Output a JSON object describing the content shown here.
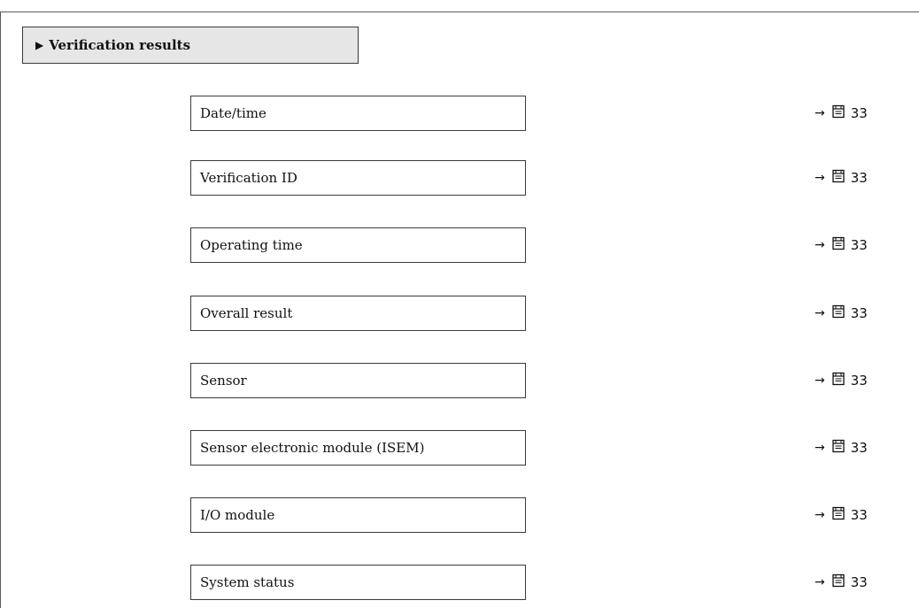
{
  "section": {
    "title": "Verification results",
    "expand_icon": "triangle-right-icon"
  },
  "parameters": [
    {
      "label": "Date/time",
      "ref_arrow": "→",
      "ref_page": "33"
    },
    {
      "label": "Verification ID",
      "ref_arrow": "→",
      "ref_page": "33"
    },
    {
      "label": "Operating time",
      "ref_arrow": "→",
      "ref_page": "33"
    },
    {
      "label": "Overall result",
      "ref_arrow": "→",
      "ref_page": "33"
    },
    {
      "label": "Sensor",
      "ref_arrow": "→",
      "ref_page": "33"
    },
    {
      "label": "Sensor electronic module (ISEM)",
      "ref_arrow": "→",
      "ref_page": "33"
    },
    {
      "label": "I/O module",
      "ref_arrow": "→",
      "ref_page": "33"
    },
    {
      "label": "System status",
      "ref_arrow": "→",
      "ref_page": "33"
    }
  ],
  "icons": {
    "page_reference": "book-page-icon"
  }
}
